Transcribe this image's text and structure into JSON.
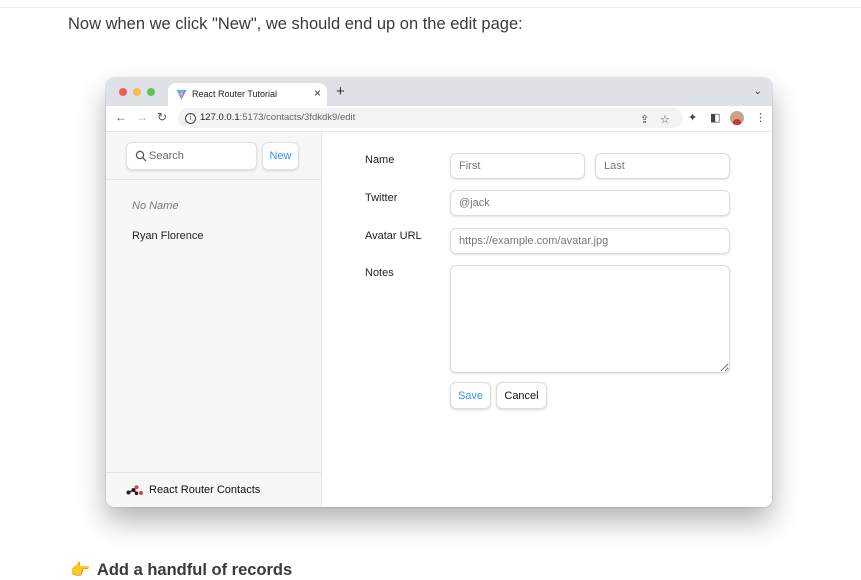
{
  "article": {
    "intro": "Now when we click \"New\", we should end up on the edit page:",
    "next_step_emoji": "👉",
    "next_step": "Add a handful of records"
  },
  "browser": {
    "tab_title": "React Router Tutorial",
    "url_host": "127.0.0.1",
    "url_rest": ":5173/contacts/3fdkdk9/edit"
  },
  "sidebar": {
    "search_placeholder": "Search",
    "new_label": "New",
    "contacts": [
      "No Name",
      "Ryan Florence"
    ],
    "footer": "React Router Contacts"
  },
  "form": {
    "name_label": "Name",
    "first_placeholder": "First",
    "last_placeholder": "Last",
    "twitter_label": "Twitter",
    "twitter_placeholder": "@jack",
    "avatar_label": "Avatar URL",
    "avatar_placeholder": "https://example.com/avatar.jpg",
    "notes_label": "Notes",
    "save_label": "Save",
    "cancel_label": "Cancel"
  },
  "colors": {
    "accent": "#3992ff",
    "traffic_red": "#ee5f57",
    "traffic_yellow": "#f4bd4f",
    "traffic_green": "#5fc454"
  }
}
